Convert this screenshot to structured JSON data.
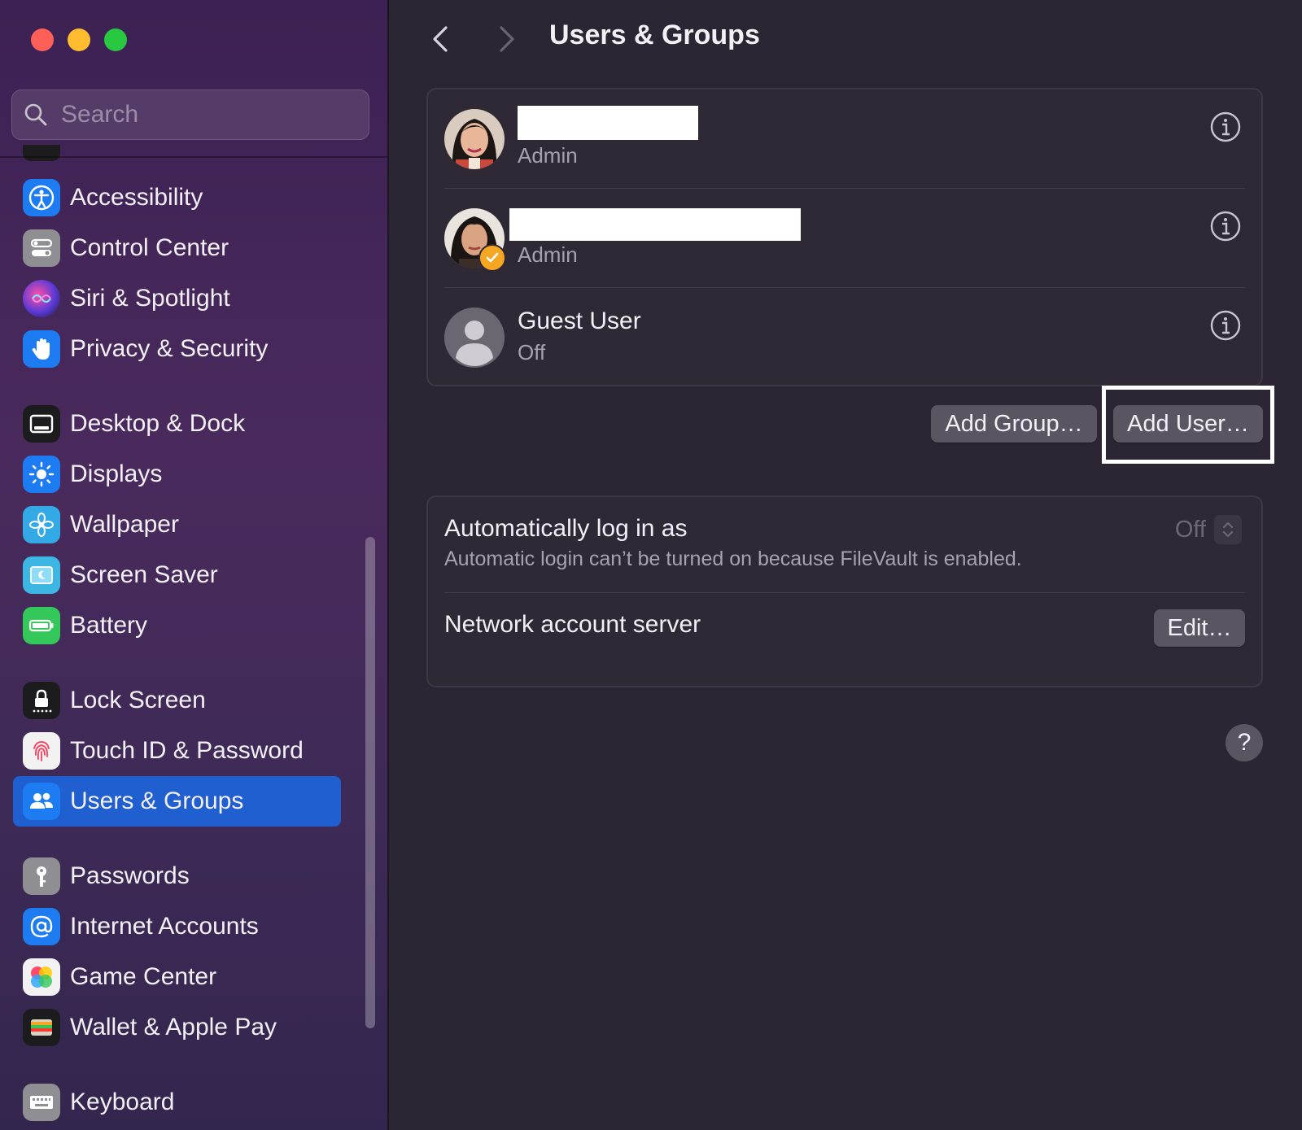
{
  "sidebar": {
    "search_placeholder": "Search",
    "items": [
      {
        "label": "Accessibility",
        "icon": "accessibility-icon",
        "color": "#1e7cf2"
      },
      {
        "label": "Control Center",
        "icon": "control-center-icon",
        "color": "#8e8e93"
      },
      {
        "label": "Siri & Spotlight",
        "icon": "siri-icon",
        "color": "#6b3fd4"
      },
      {
        "label": "Privacy & Security",
        "icon": "hand-icon",
        "color": "#1e7cf2"
      },
      {
        "label": "Desktop & Dock",
        "icon": "dock-icon",
        "color": "#1c1c1e"
      },
      {
        "label": "Displays",
        "icon": "sun-icon",
        "color": "#1e7cf2"
      },
      {
        "label": "Wallpaper",
        "icon": "flower-icon",
        "color": "#33a9e6"
      },
      {
        "label": "Screen Saver",
        "icon": "screen-saver-icon",
        "color": "#3cb6e3"
      },
      {
        "label": "Battery",
        "icon": "battery-icon",
        "color": "#34c759"
      },
      {
        "label": "Lock Screen",
        "icon": "lock-icon",
        "color": "#1c1c1e"
      },
      {
        "label": "Touch ID & Password",
        "icon": "fingerprint-icon",
        "color": "#f2f2f2"
      },
      {
        "label": "Users & Groups",
        "icon": "users-icon",
        "color": "#1e7cf2",
        "selected": true
      },
      {
        "label": "Passwords",
        "icon": "key-icon",
        "color": "#8e8e93"
      },
      {
        "label": "Internet Accounts",
        "icon": "at-icon",
        "color": "#1e7cf2"
      },
      {
        "label": "Game Center",
        "icon": "game-center-icon",
        "color": "#f2f2f2"
      },
      {
        "label": "Wallet & Apple Pay",
        "icon": "wallet-icon",
        "color": "#1c1c1e"
      },
      {
        "label": "Keyboard",
        "icon": "keyboard-icon",
        "color": "#8e8e93"
      }
    ]
  },
  "header": {
    "title": "Users & Groups"
  },
  "users": [
    {
      "role": "Admin"
    },
    {
      "role": "Admin"
    },
    {
      "name": "Guest User",
      "role": "Off"
    }
  ],
  "buttons": {
    "add_group": "Add Group…",
    "add_user": "Add User…",
    "edit": "Edit…",
    "help": "?"
  },
  "settings": {
    "auto_login_title": "Automatically log in as",
    "auto_login_sub": "Automatic login can’t be turned on because FileVault is enabled.",
    "auto_login_value": "Off",
    "network_server_title": "Network account server"
  },
  "colors": {
    "accent": "#1f5fd0",
    "background": "#2c2533"
  }
}
